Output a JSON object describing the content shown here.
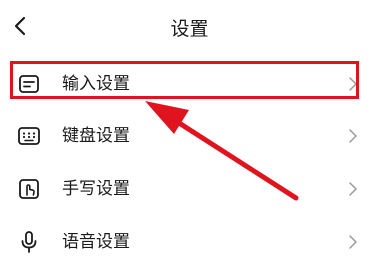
{
  "header": {
    "title": "设置",
    "back_icon": "chevron-left-icon"
  },
  "menu": {
    "items": [
      {
        "label": "输入设置",
        "icon": "input-box-icon"
      },
      {
        "label": "键盘设置",
        "icon": "keyboard-icon"
      },
      {
        "label": "手写设置",
        "icon": "handwriting-icon"
      },
      {
        "label": "语音设置",
        "icon": "microphone-icon"
      }
    ]
  },
  "annotation": {
    "highlight_color": "#e0141f"
  }
}
